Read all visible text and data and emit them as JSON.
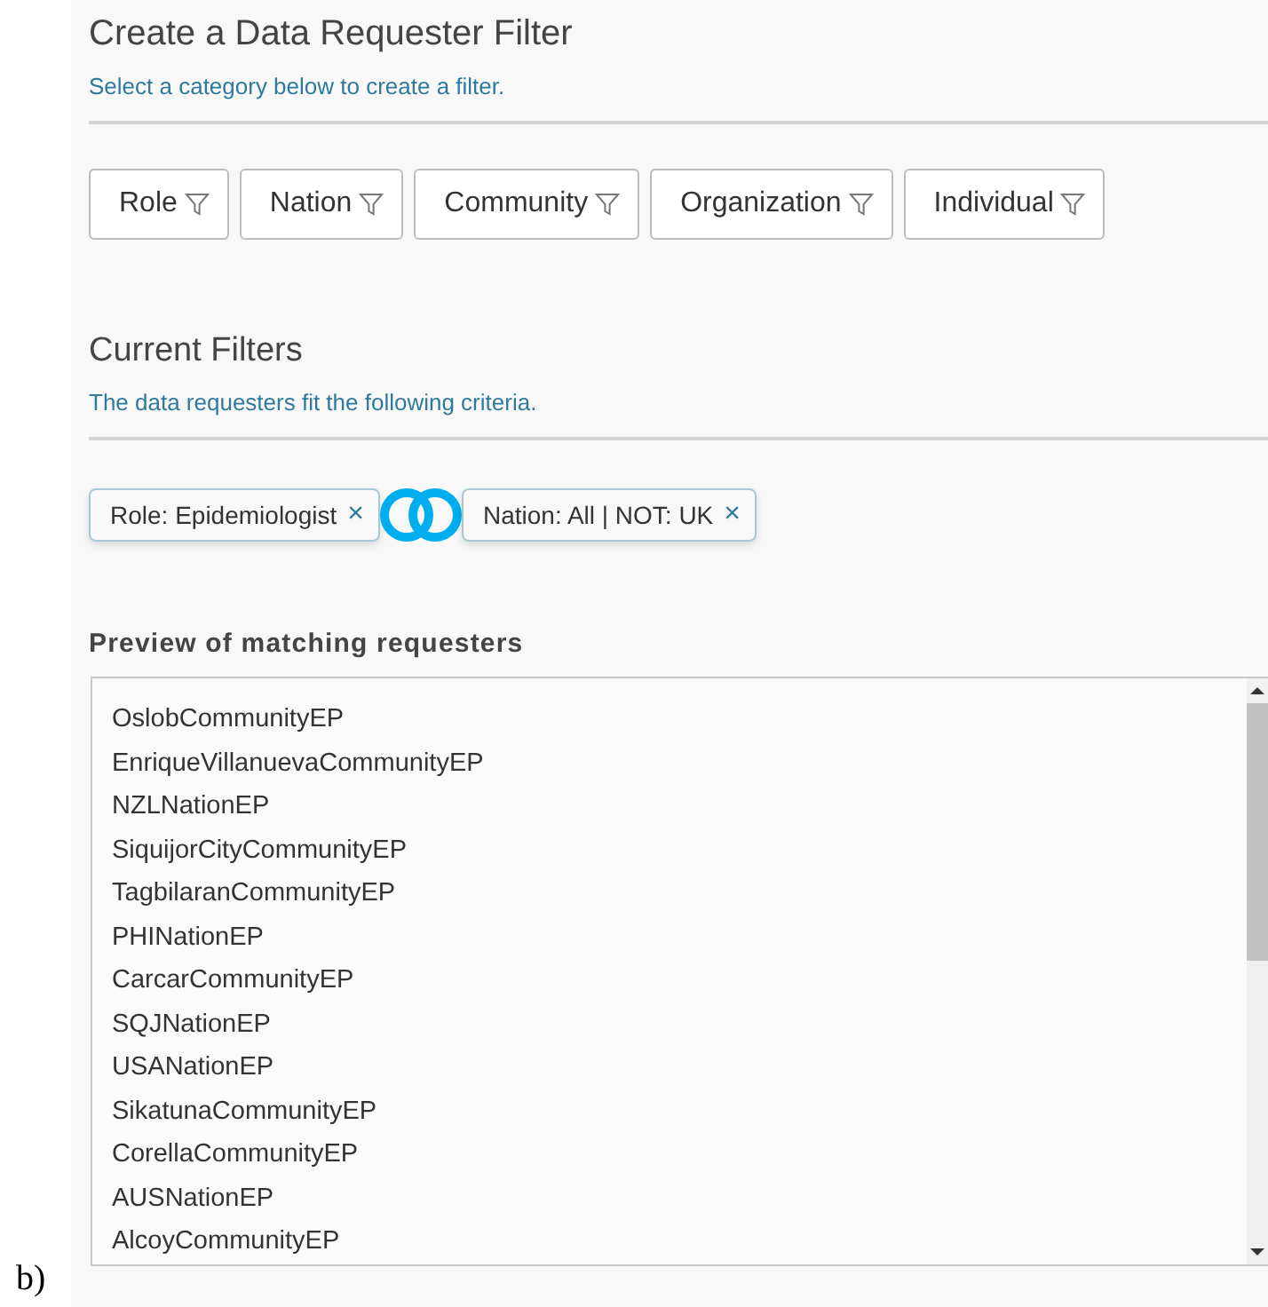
{
  "figure_label": "b)",
  "create": {
    "title": "Create a Data Requester Filter",
    "subtitle": "Select a category below to create a filter.",
    "categories": [
      {
        "label": "Role"
      },
      {
        "label": "Nation"
      },
      {
        "label": "Community"
      },
      {
        "label": "Organization"
      },
      {
        "label": "Individual"
      }
    ]
  },
  "current": {
    "title": "Current Filters",
    "subtitle": "The data requesters fit the following criteria.",
    "filters": [
      {
        "label": "Role: Epidemiologist",
        "remove": "×"
      },
      {
        "label": "Nation: All | NOT: UK",
        "remove": "×"
      }
    ]
  },
  "preview": {
    "title": "Preview of matching requesters",
    "items": [
      "OslobCommunityEP",
      "EnriqueVillanuevaCommunityEP",
      "NZLNationEP",
      "SiquijorCityCommunityEP",
      "TagbilaranCommunityEP",
      "PHINationEP",
      "CarcarCommunityEP",
      "SQJNationEP",
      "USANationEP",
      "SikatunaCommunityEP",
      "CorellaCommunityEP",
      "AUSNationEP",
      "AlcoyCommunityEP"
    ]
  }
}
